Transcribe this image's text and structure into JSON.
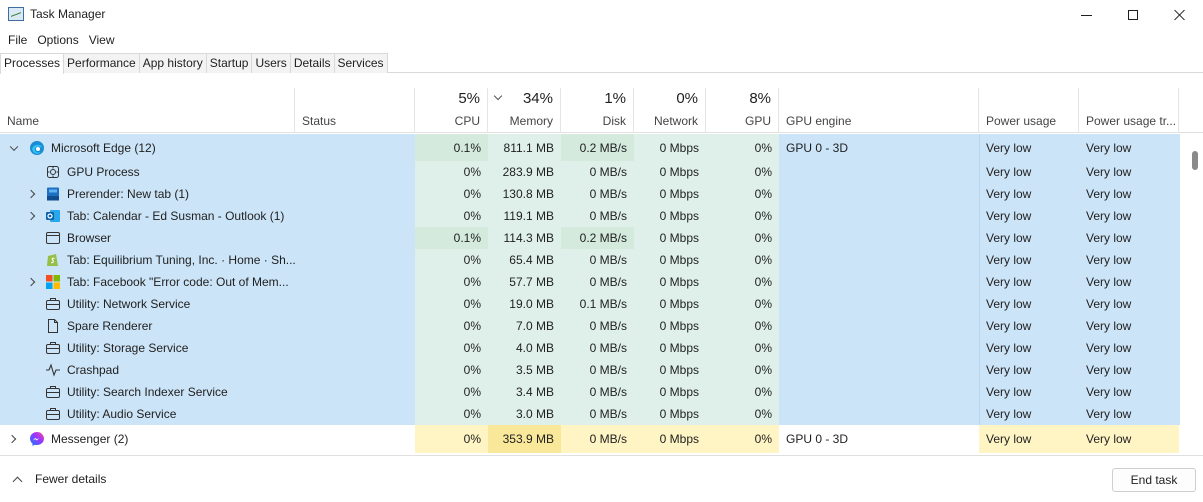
{
  "window": {
    "title": "Task Manager"
  },
  "menu": [
    "File",
    "Options",
    "View"
  ],
  "tabs": [
    "Processes",
    "Performance",
    "App history",
    "Startup",
    "Users",
    "Details",
    "Services"
  ],
  "header": {
    "name": "Name",
    "status": "Status",
    "cpu": {
      "pct": "5%",
      "label": "CPU"
    },
    "memory": {
      "pct": "34%",
      "label": "Memory"
    },
    "disk": {
      "pct": "1%",
      "label": "Disk"
    },
    "network": {
      "pct": "0%",
      "label": "Network"
    },
    "gpu": {
      "pct": "8%",
      "label": "GPU"
    },
    "gpu_engine": "GPU engine",
    "power": "Power usage",
    "power_trend": "Power usage tr..."
  },
  "processes": [
    {
      "name": "Microsoft Edge (12)",
      "icon": "edge-icon",
      "cpu": "0.1%",
      "memory": "811.1 MB",
      "disk": "0.2 MB/s",
      "network": "0 Mbps",
      "gpu": "0%",
      "gpu_engine": "GPU 0 - 3D",
      "power": "Very low",
      "power_trend": "Very low"
    },
    {
      "name": "GPU Process",
      "icon": "gear-chip-icon",
      "cpu": "0%",
      "memory": "283.9 MB",
      "disk": "0 MB/s",
      "network": "0 Mbps",
      "gpu": "0%",
      "gpu_engine": "",
      "power": "Very low",
      "power_trend": "Very low"
    },
    {
      "name": "Prerender: New tab (1)",
      "icon": "tab-icon",
      "cpu": "0%",
      "memory": "130.8 MB",
      "disk": "0 MB/s",
      "network": "0 Mbps",
      "gpu": "0%",
      "gpu_engine": "",
      "power": "Very low",
      "power_trend": "Very low"
    },
    {
      "name": "Tab: Calendar - Ed Susman - Outlook (1)",
      "icon": "outlook-icon",
      "cpu": "0%",
      "memory": "119.1 MB",
      "disk": "0 MB/s",
      "network": "0 Mbps",
      "gpu": "0%",
      "gpu_engine": "",
      "power": "Very low",
      "power_trend": "Very low"
    },
    {
      "name": "Browser",
      "icon": "browser-window-icon",
      "cpu": "0.1%",
      "memory": "114.3 MB",
      "disk": "0.2 MB/s",
      "network": "0 Mbps",
      "gpu": "0%",
      "gpu_engine": "",
      "power": "Very low",
      "power_trend": "Very low"
    },
    {
      "name": "Tab: Equilibrium Tuning, Inc. · Home · Sh...",
      "icon": "shopify-icon",
      "cpu": "0%",
      "memory": "65.4 MB",
      "disk": "0 MB/s",
      "network": "0 Mbps",
      "gpu": "0%",
      "gpu_engine": "",
      "power": "Very low",
      "power_trend": "Very low"
    },
    {
      "name": "Tab: Facebook \"Error code: Out of Mem...",
      "icon": "microsoft-squares-icon",
      "cpu": "0%",
      "memory": "57.7 MB",
      "disk": "0 MB/s",
      "network": "0 Mbps",
      "gpu": "0%",
      "gpu_engine": "",
      "power": "Very low",
      "power_trend": "Very low"
    },
    {
      "name": "Utility: Network Service",
      "icon": "toolbox-icon",
      "cpu": "0%",
      "memory": "19.0 MB",
      "disk": "0.1 MB/s",
      "network": "0 Mbps",
      "gpu": "0%",
      "gpu_engine": "",
      "power": "Very low",
      "power_trend": "Very low"
    },
    {
      "name": "Spare Renderer",
      "icon": "document-icon",
      "cpu": "0%",
      "memory": "7.0 MB",
      "disk": "0 MB/s",
      "network": "0 Mbps",
      "gpu": "0%",
      "gpu_engine": "",
      "power": "Very low",
      "power_trend": "Very low"
    },
    {
      "name": "Utility: Storage Service",
      "icon": "toolbox-icon",
      "cpu": "0%",
      "memory": "4.0 MB",
      "disk": "0 MB/s",
      "network": "0 Mbps",
      "gpu": "0%",
      "gpu_engine": "",
      "power": "Very low",
      "power_trend": "Very low"
    },
    {
      "name": "Crashpad",
      "icon": "pulse-icon",
      "cpu": "0%",
      "memory": "3.5 MB",
      "disk": "0 MB/s",
      "network": "0 Mbps",
      "gpu": "0%",
      "gpu_engine": "",
      "power": "Very low",
      "power_trend": "Very low"
    },
    {
      "name": "Utility: Search Indexer Service",
      "icon": "toolbox-icon",
      "cpu": "0%",
      "memory": "3.4 MB",
      "disk": "0 MB/s",
      "network": "0 Mbps",
      "gpu": "0%",
      "gpu_engine": "",
      "power": "Very low",
      "power_trend": "Very low"
    },
    {
      "name": "Utility: Audio Service",
      "icon": "toolbox-icon",
      "cpu": "0%",
      "memory": "3.0 MB",
      "disk": "0 MB/s",
      "network": "0 Mbps",
      "gpu": "0%",
      "gpu_engine": "",
      "power": "Very low",
      "power_trend": "Very low"
    },
    {
      "name": "Messenger (2)",
      "icon": "messenger-icon",
      "cpu": "0%",
      "memory": "353.9 MB",
      "disk": "0 MB/s",
      "network": "0 Mbps",
      "gpu": "0%",
      "gpu_engine": "GPU 0 - 3D",
      "power": "Very low",
      "power_trend": "Very low"
    }
  ],
  "footer": {
    "fewer_details": "Fewer details",
    "end_task": "End task"
  },
  "colors": {
    "selected_row": "#cce4f7",
    "heat_low": "#fff4c4",
    "heat_mid": "#f9e79a",
    "accent": "#0078d4"
  }
}
